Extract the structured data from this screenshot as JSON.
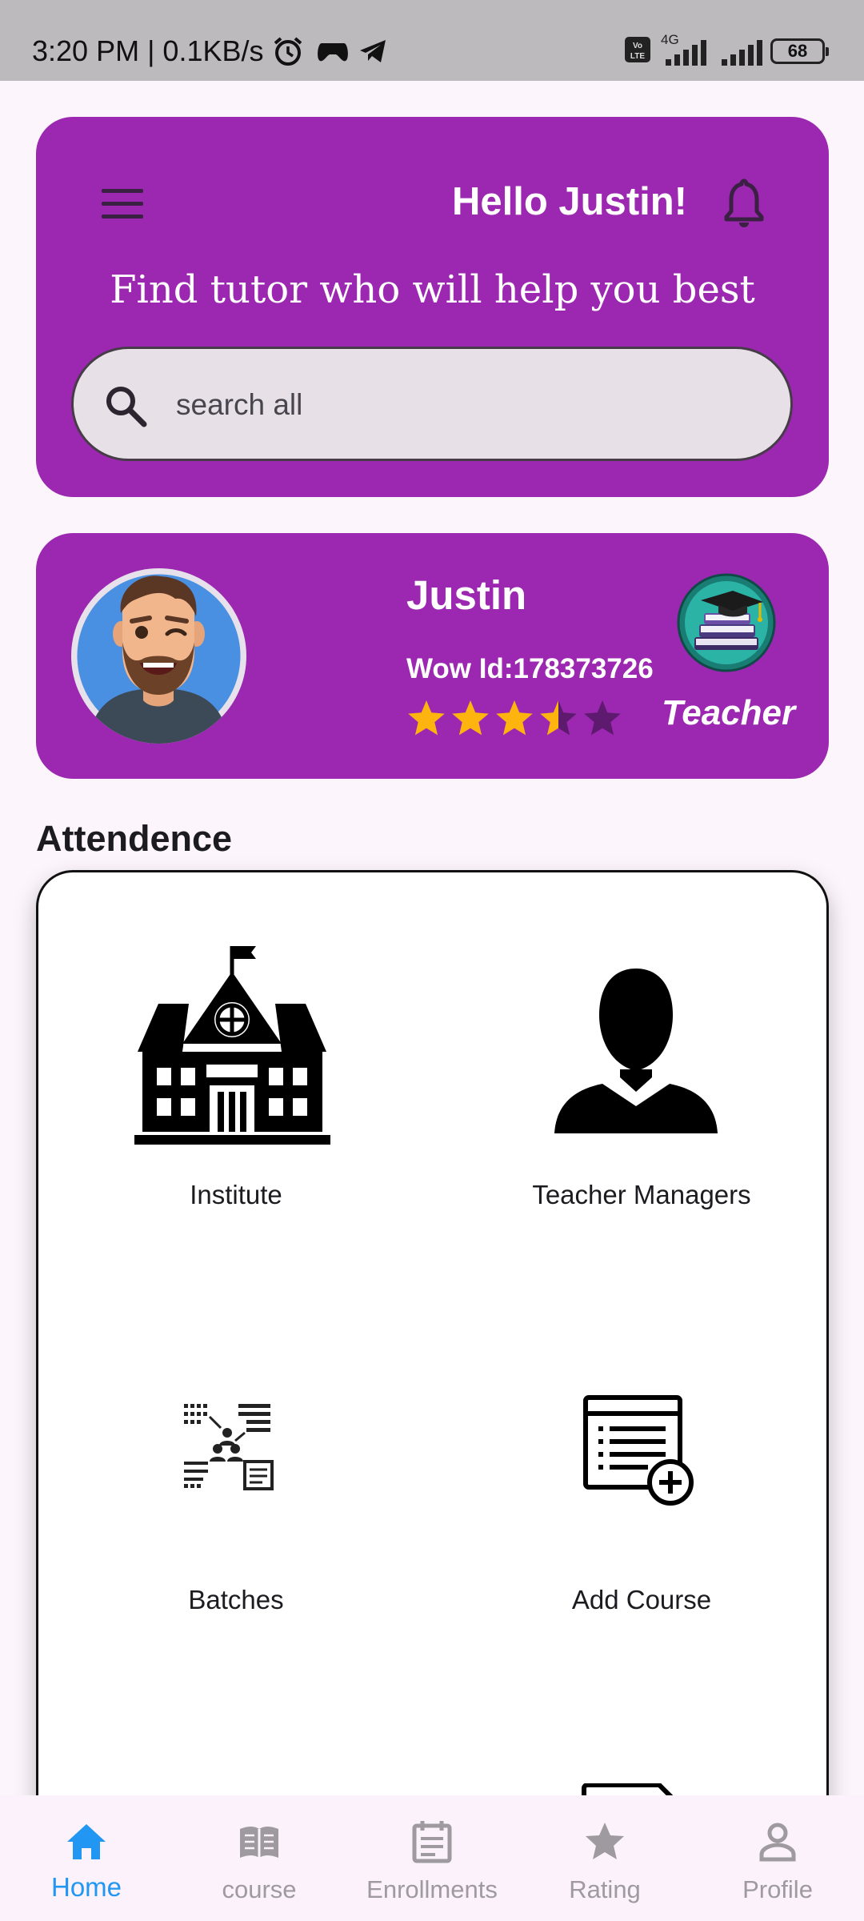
{
  "status_bar": {
    "time_speed": "3:20 PM | 0.1KB/s",
    "network": "4G",
    "battery": "68"
  },
  "header": {
    "greeting": "Hello Justin!",
    "tagline": "Find tutor who will help you best",
    "search": {
      "placeholder": "search all",
      "value": ""
    }
  },
  "profile": {
    "name": "Justin",
    "wow_id": "Wow Id:178373726",
    "rating": 3.5,
    "rating_max": 5,
    "role": "Teacher"
  },
  "attendance": {
    "title": "Attendence",
    "tiles": [
      {
        "label": "Institute",
        "icon": "institute-icon"
      },
      {
        "label": "Teacher Managers",
        "icon": "teacher-icon"
      },
      {
        "label": "Batches",
        "icon": "batches-icon"
      },
      {
        "label": "Add Course",
        "icon": "add-course-icon"
      }
    ]
  },
  "bottom_nav": {
    "items": [
      {
        "label": "Home",
        "icon": "home-icon",
        "active": true
      },
      {
        "label": "course",
        "icon": "book-icon",
        "active": false
      },
      {
        "label": "Enrollments",
        "icon": "calendar-icon",
        "active": false
      },
      {
        "label": "Rating",
        "icon": "star-icon",
        "active": false
      },
      {
        "label": "Profile",
        "icon": "person-icon",
        "active": false
      }
    ]
  },
  "colors": {
    "primary": "#9c27b0",
    "nav_active": "#2196f3",
    "nav_inactive": "#9e9a9f",
    "star": "#fdb40f",
    "star_empty": "#5e1a6e"
  }
}
